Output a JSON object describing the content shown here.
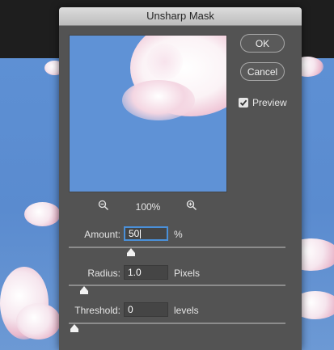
{
  "dialog": {
    "title": "Unsharp Mask"
  },
  "buttons": {
    "ok": "OK",
    "cancel": "Cancel"
  },
  "preview": {
    "label": "Preview",
    "checked": true
  },
  "zoom": {
    "level": "100%",
    "zoom_out_icon": "zoom-out-magnifier",
    "zoom_in_icon": "zoom-in-magnifier"
  },
  "amount": {
    "label": "Amount:",
    "value": "50",
    "unit": "%",
    "slider_fraction": 0.2
  },
  "radius": {
    "label": "Radius:",
    "value": "1.0",
    "unit": "Pixels",
    "slider_fraction": 0.04
  },
  "threshold": {
    "label": "Threshold:",
    "value": "0",
    "unit": "levels",
    "slider_fraction": 0.0
  },
  "colors": {
    "dialog_bg": "#535353",
    "focus_ring": "#4a90d9",
    "sky": "#5f92d6"
  }
}
